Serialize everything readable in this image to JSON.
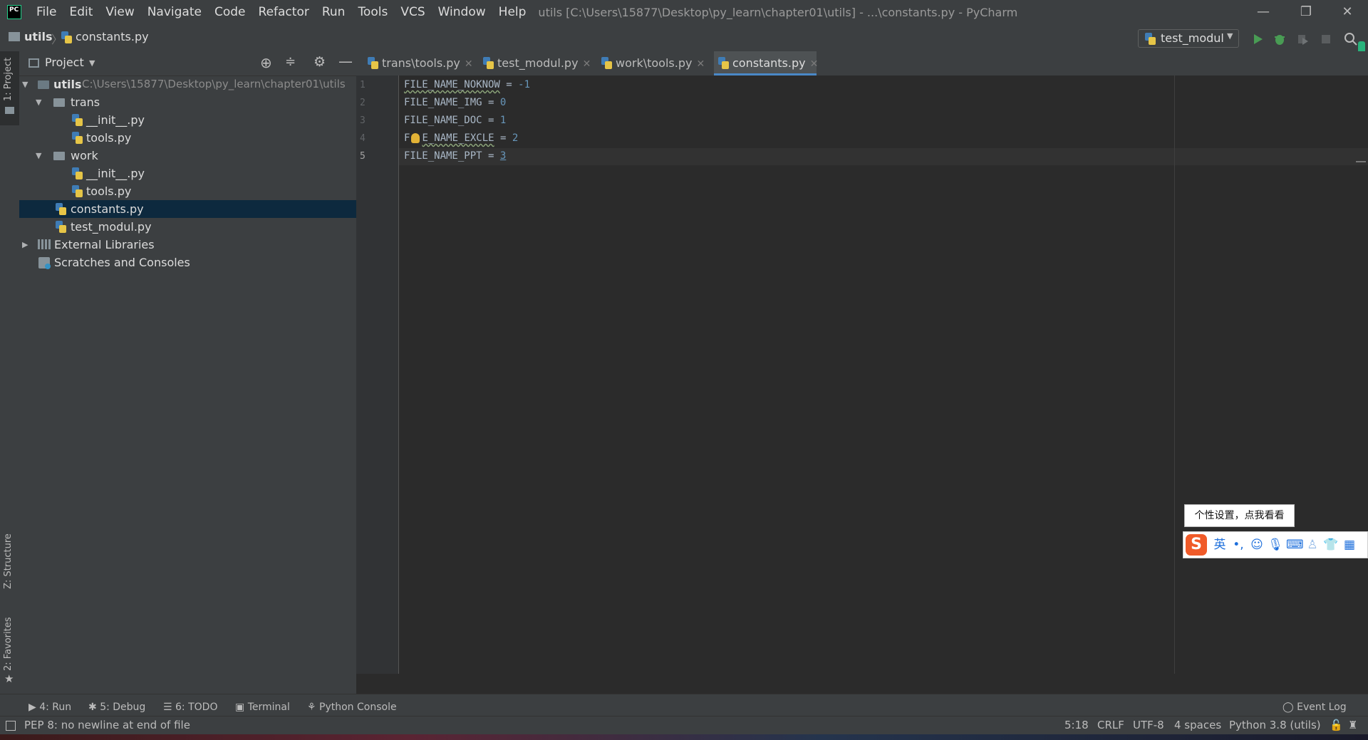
{
  "menu": [
    "File",
    "Edit",
    "View",
    "Navigate",
    "Code",
    "Refactor",
    "Run",
    "Tools",
    "VCS",
    "Window",
    "Help"
  ],
  "window_title": "utils [C:\\Users\\15877\\Desktop\\py_learn\\chapter01\\utils] - ...\\constants.py - PyCharm",
  "window_controls": {
    "minimize": "—",
    "restore": "❐",
    "close": "✕"
  },
  "breadcrumb": {
    "root": "utils",
    "file": "constants.py"
  },
  "run_config": "test_modul",
  "left_strip": {
    "project": "1: Project",
    "structure": "Z: Structure",
    "favorites": "2: Favorites"
  },
  "project_panel": {
    "title": "Project",
    "tree": [
      {
        "label": "utils",
        "path": "C:\\Users\\15877\\Desktop\\py_learn\\chapter01\\utils"
      },
      {
        "label": "trans"
      },
      {
        "label": "__init__.py"
      },
      {
        "label": "tools.py"
      },
      {
        "label": "work"
      },
      {
        "label": "__init__.py"
      },
      {
        "label": "tools.py"
      },
      {
        "label": "constants.py"
      },
      {
        "label": "test_modul.py"
      },
      {
        "label": "External Libraries"
      },
      {
        "label": "Scratches and Consoles"
      }
    ]
  },
  "tabs": [
    {
      "label": "trans\\tools.py"
    },
    {
      "label": "test_modul.py"
    },
    {
      "label": "work\\tools.py"
    },
    {
      "label": "constants.py",
      "active": true
    }
  ],
  "editor": {
    "line_numbers": [
      "1",
      "2",
      "3",
      "4",
      "5"
    ],
    "lines": [
      {
        "name": "FILE_NAME_NOKNOW",
        "op": " = ",
        "value": "-1"
      },
      {
        "name": "FILE_NAME_IMG",
        "op": " = ",
        "value": "0"
      },
      {
        "name": "FILE_NAME_DOC",
        "op": " = ",
        "value": "1"
      },
      {
        "pre": "F",
        "name": "E_NAME_EXCLE",
        "op": " = ",
        "value": "2"
      },
      {
        "name": "FILE_NAME_PPT",
        "op": " = ",
        "value": "3"
      }
    ]
  },
  "bottom_tabs": {
    "run": "4: Run",
    "debug": "5: Debug",
    "todo": "6: TODO",
    "terminal": "Terminal",
    "python_console": "Python Console",
    "event_log": "Event Log"
  },
  "status": {
    "message": "PEP 8: no newline at end of file",
    "position": "5:18",
    "line_sep": "CRLF",
    "encoding": "UTF-8",
    "indent": "4 spaces",
    "interpreter": "Python 3.8 (utils)"
  },
  "ime": {
    "tooltip": "个性设置，点我看看",
    "logo": "S",
    "mode": "英",
    "punct": "•,"
  },
  "colors": {
    "accent": "#4a88c7",
    "selection": "#0d293e",
    "number": "#6897bb",
    "code": "#a9b7c6"
  }
}
